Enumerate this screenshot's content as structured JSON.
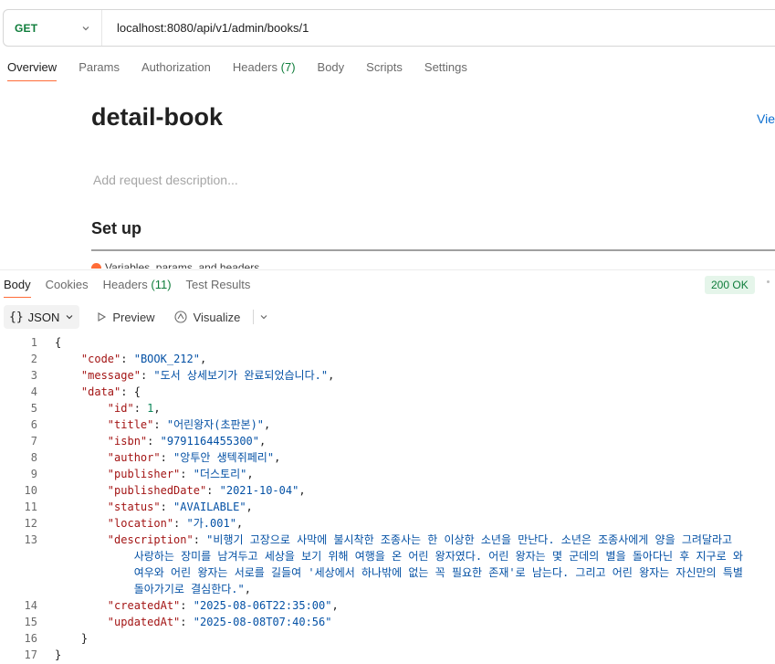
{
  "request": {
    "method": "GET",
    "url": "localhost:8080/api/v1/admin/books/1"
  },
  "request_tabs": [
    {
      "label": "Overview",
      "count": ""
    },
    {
      "label": "Params",
      "count": ""
    },
    {
      "label": "Authorization",
      "count": ""
    },
    {
      "label": "Headers",
      "count": "(7)"
    },
    {
      "label": "Body",
      "count": ""
    },
    {
      "label": "Scripts",
      "count": ""
    },
    {
      "label": "Settings",
      "count": ""
    }
  ],
  "docs": {
    "title": "detail-book",
    "view_link": "Vie",
    "description_placeholder": "Add request description...",
    "setup_heading": "Set up",
    "setup_item": "Variables, params, and headers"
  },
  "response": {
    "tabs": [
      {
        "label": "Body",
        "count": ""
      },
      {
        "label": "Cookies",
        "count": ""
      },
      {
        "label": "Headers",
        "count": "(11)"
      },
      {
        "label": "Test Results",
        "count": ""
      }
    ],
    "status": "200 OK",
    "format_icon": "{}",
    "format": "JSON",
    "preview_label": "Preview",
    "visualize_label": "Visualize"
  },
  "body_json": {
    "code": "BOOK_212",
    "message": "도서 상세보기가 완료되었습니다.",
    "data": {
      "id": "1",
      "title": "어린왕자(초판본)",
      "isbn": "9791164455300",
      "author": "앙투안 생텍쥐페리",
      "publisher": "더스토리",
      "publishedDate": "2021-10-04",
      "status": "AVAILABLE",
      "location": "가.001",
      "description_lines": [
        "비행기 고장으로 사막에 불시착한 조종사는 한 이상한 소년을 만난다. 소년은 조종사에게 양을 그려달라고",
        "사랑하는 장미를 남겨두고 세상을 보기 위해 여행을 온 어린 왕자였다. 어린 왕자는 몇 군데의 별을 돌아다닌 후 지구로 와",
        "여우와 어린 왕자는 서로를 길들여 '세상에서 하나밖에 없는 꼭 필요한 존재'로 남는다. 그리고 어린 왕자는 자신만의 특별",
        "돌아가기로 결심한다."
      ],
      "createdAt": "2025-08-06T22:35:00",
      "updatedAt": "2025-08-08T07:40:56"
    }
  },
  "line_numbers": [
    "1",
    "2",
    "3",
    "4",
    "5",
    "6",
    "7",
    "8",
    "9",
    "10",
    "11",
    "12",
    "13",
    "",
    "",
    "",
    "14",
    "15",
    "16",
    "17"
  ]
}
